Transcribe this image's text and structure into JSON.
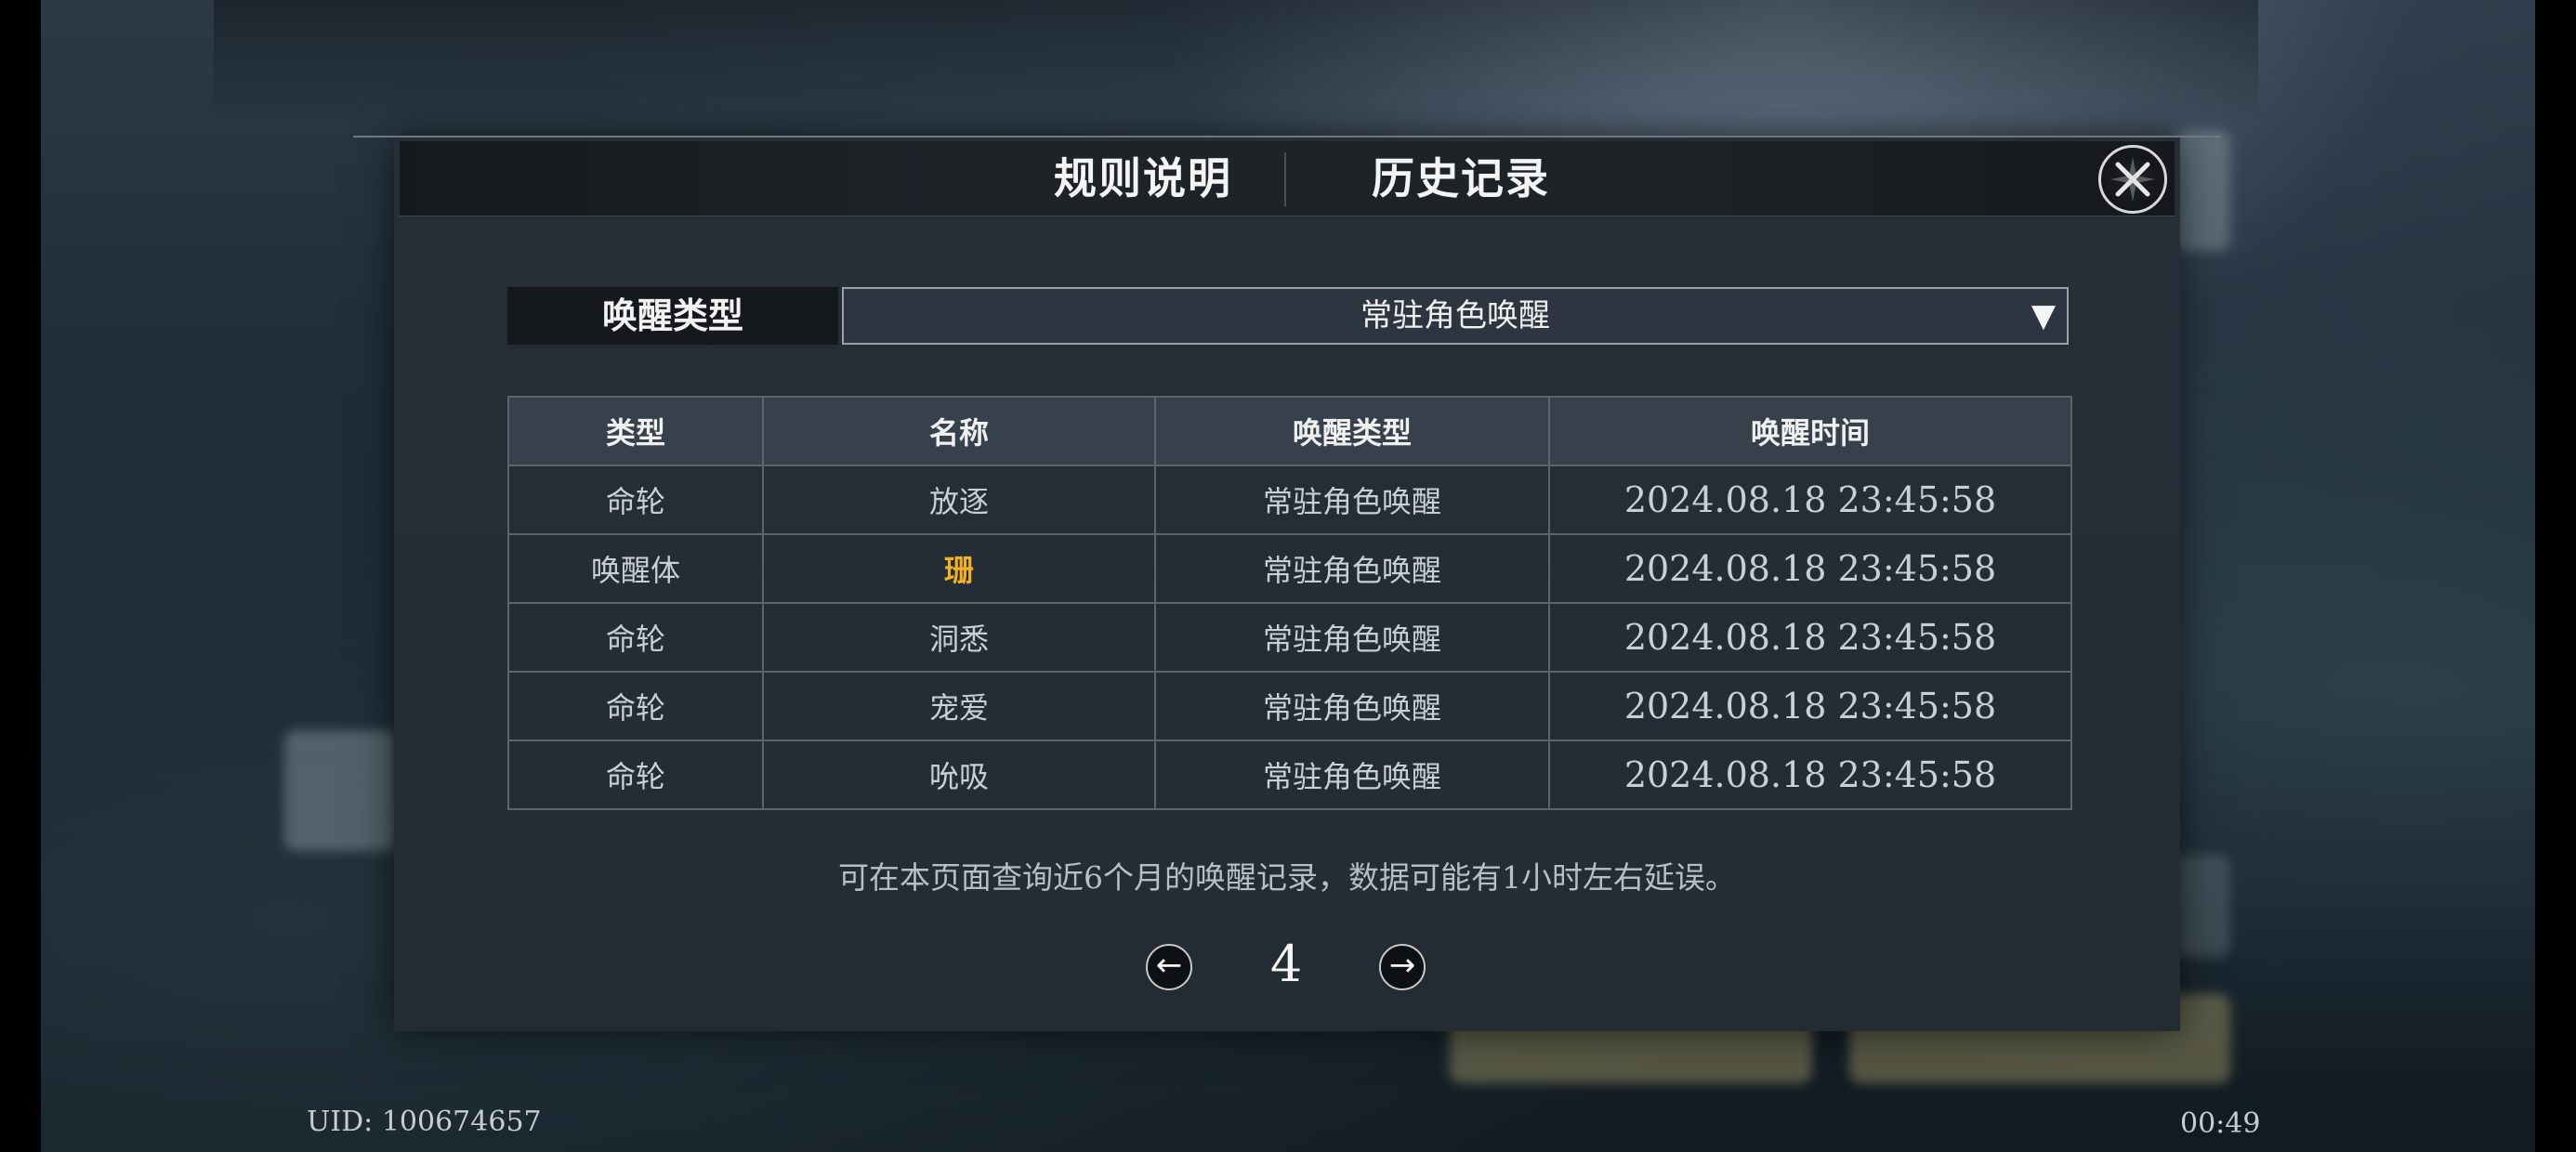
{
  "tabs": {
    "rules": "规则说明",
    "history": "历史记录"
  },
  "filter": {
    "label": "唤醒类型",
    "selected": "常驻角色唤醒"
  },
  "table": {
    "headers": [
      "类型",
      "名称",
      "唤醒类型",
      "唤醒时间"
    ],
    "rows": [
      [
        "命轮",
        "放逐",
        "常驻角色唤醒",
        "2024.08.18 23:45:58"
      ],
      [
        "唤醒体",
        "珊",
        "常驻角色唤醒",
        "2024.08.18 23:45:58"
      ],
      [
        "命轮",
        "洞悉",
        "常驻角色唤醒",
        "2024.08.18 23:45:58"
      ],
      [
        "命轮",
        "宠爱",
        "常驻角色唤醒",
        "2024.08.18 23:45:58"
      ],
      [
        "命轮",
        "吮吸",
        "常驻角色唤醒",
        "2024.08.18 23:45:58"
      ]
    ]
  },
  "note": "可在本页面查询近6个月的唤醒记录，数据可能有1小时左右延误。",
  "pager": {
    "page": "4"
  },
  "footer": {
    "uid": "UID: 100674657",
    "clock": "00:49"
  },
  "colors": {
    "highlight": "#f0b028",
    "panel": "#262f38"
  },
  "icons": {
    "close": "close-x-icon",
    "dropdown": "triangle-down-icon",
    "prev": "arrow-left-icon",
    "next": "arrow-right-icon"
  }
}
